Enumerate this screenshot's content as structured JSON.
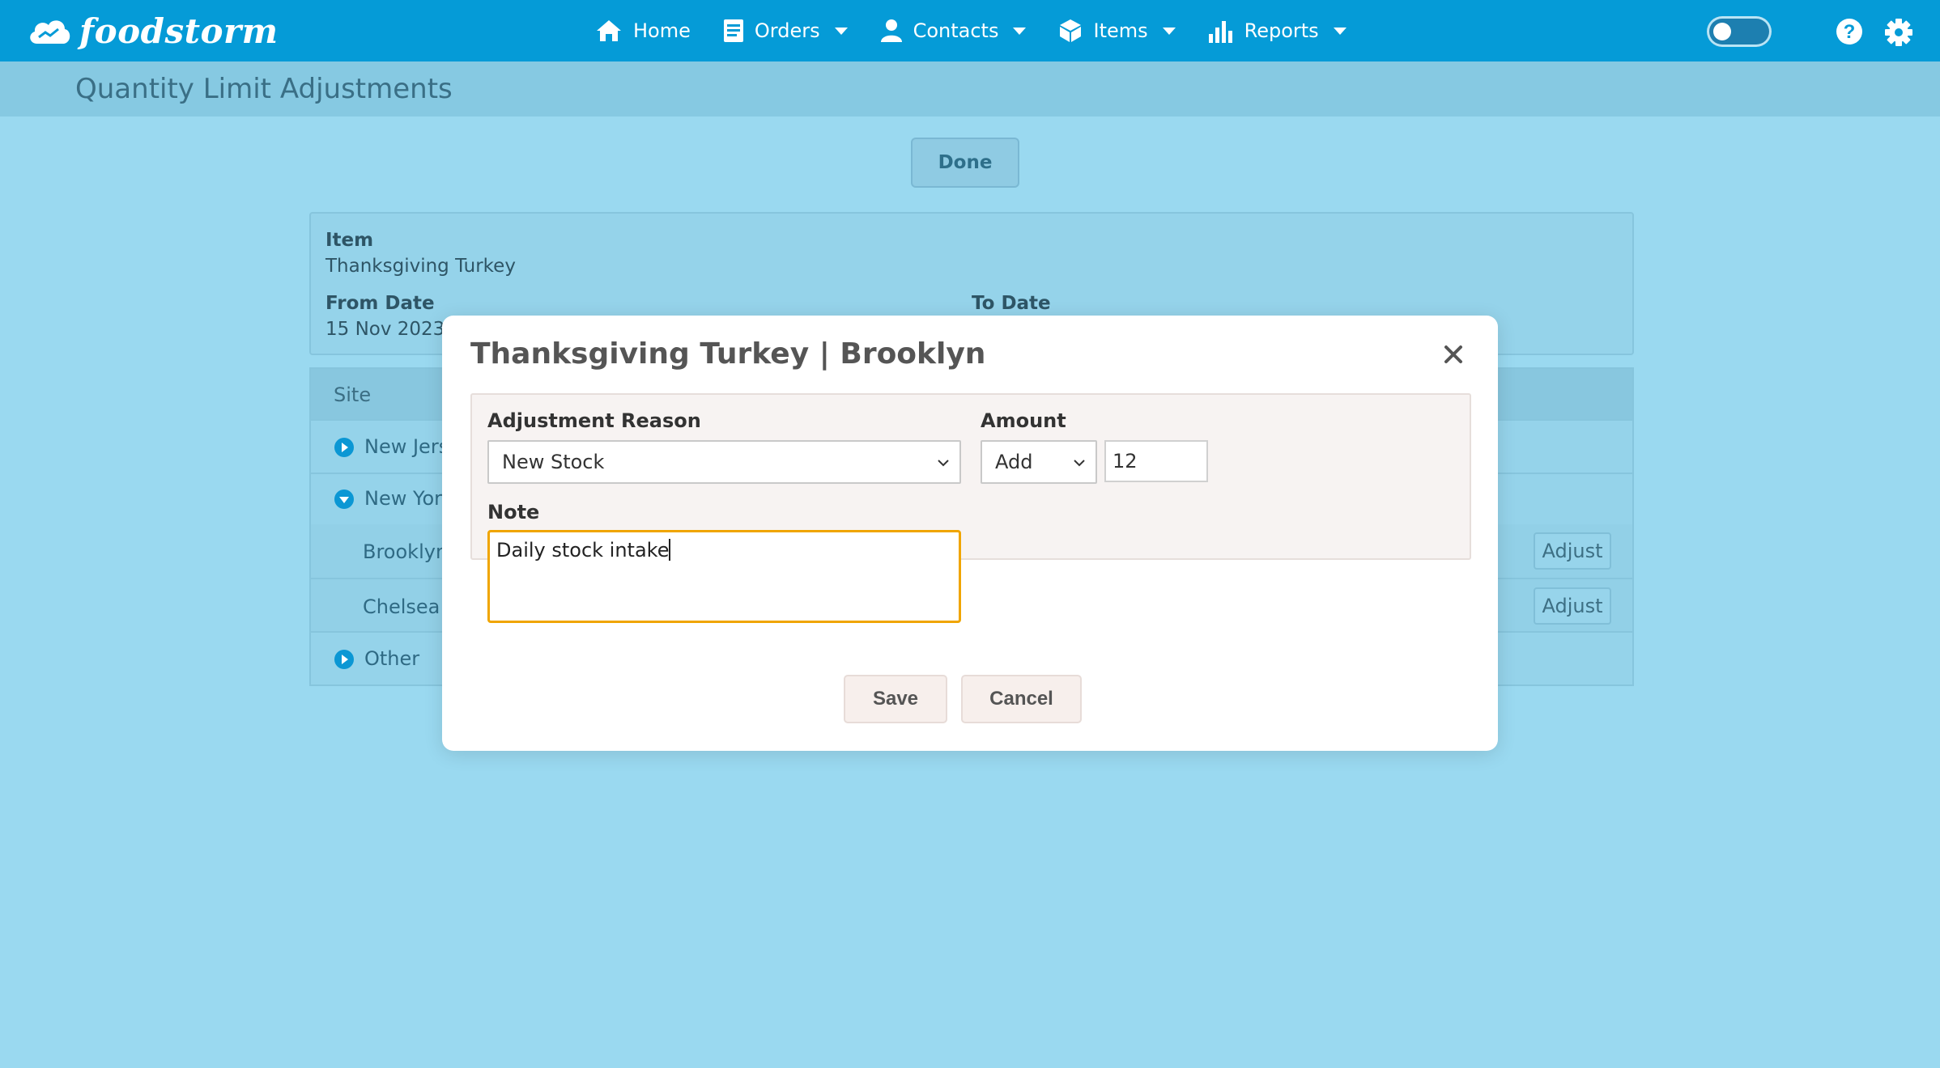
{
  "app": {
    "logo_text": "foodstorm"
  },
  "nav": {
    "items": [
      {
        "label": "Home",
        "icon": "home-icon",
        "dropdown": false
      },
      {
        "label": "Orders",
        "icon": "orders-icon",
        "dropdown": true
      },
      {
        "label": "Contacts",
        "icon": "contacts-icon",
        "dropdown": true
      },
      {
        "label": "Items",
        "icon": "items-icon",
        "dropdown": true
      },
      {
        "label": "Reports",
        "icon": "reports-icon",
        "dropdown": true
      }
    ],
    "toggle_on": false
  },
  "page": {
    "title": "Quantity Limit Adjustments",
    "done_label": "Done"
  },
  "info": {
    "item_label": "Item",
    "item_value": "Thanksgiving Turkey",
    "from_label": "From Date",
    "from_value": "15 Nov 2023",
    "to_label": "To Date"
  },
  "sites": {
    "header": "Site",
    "rows": [
      {
        "label": "New Jers",
        "type": "group",
        "expanded": false
      },
      {
        "label": "New York",
        "type": "group",
        "expanded": true
      },
      {
        "label": "Brooklyn",
        "type": "child",
        "action": "Adjust"
      },
      {
        "label": "Chelsea",
        "type": "child",
        "action": "Adjust"
      },
      {
        "label": "Other",
        "type": "group",
        "expanded": false
      }
    ]
  },
  "modal": {
    "title": "Thanksgiving Turkey | Brooklyn",
    "reason_label": "Adjustment Reason",
    "reason_value": "New Stock",
    "amount_label": "Amount",
    "amount_op": "Add",
    "amount_value": "12",
    "note_label": "Note",
    "note_value": "Daily stock intake",
    "save_label": "Save",
    "cancel_label": "Cancel"
  },
  "colors": {
    "nav_bg": "#059bd7",
    "accent_focus": "#f0a500",
    "overlay_bg": "#9ad9f0"
  }
}
